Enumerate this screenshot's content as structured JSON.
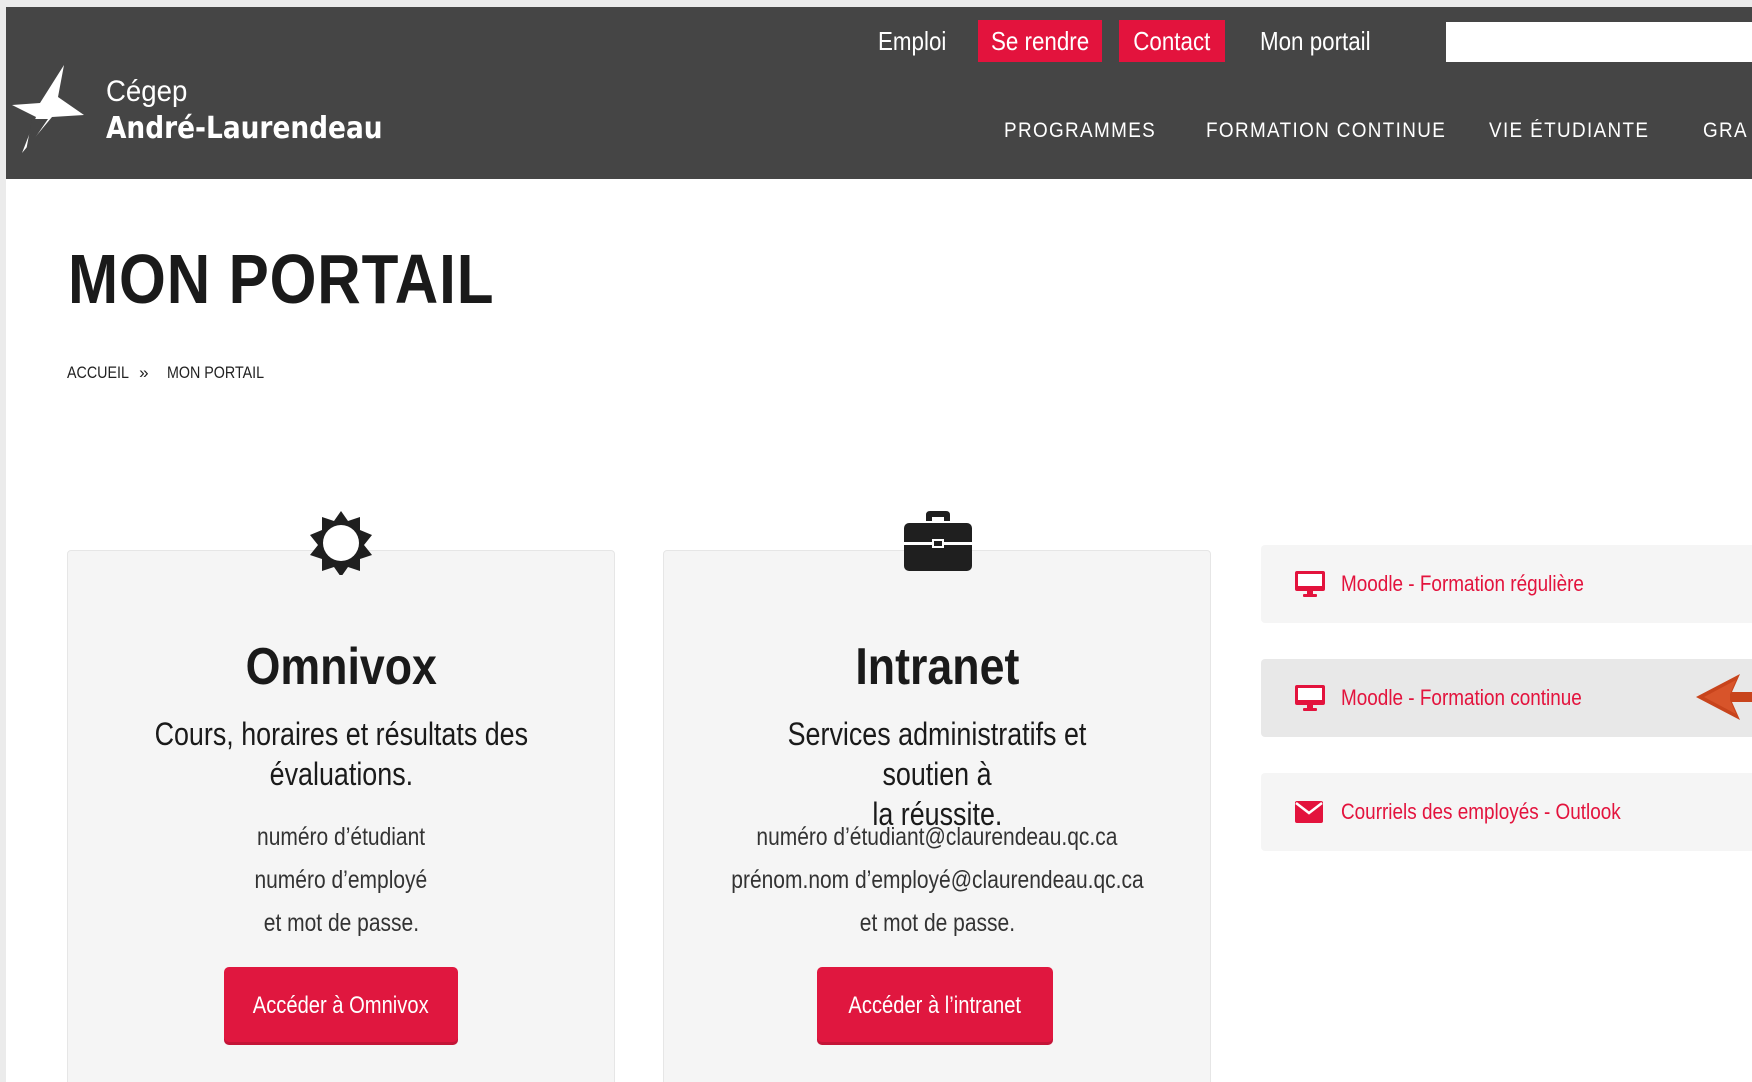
{
  "header": {
    "logo": {
      "line1": "Cégep",
      "line2": "André-Laurendeau"
    },
    "utility_nav": {
      "emploi": "Emploi",
      "se_rendre": "Se rendre",
      "contact": "Contact",
      "mon_portail": "Mon portail",
      "search_value": ""
    },
    "main_nav": [
      "PROGRAMMES",
      "FORMATION CONTINUE",
      "VIE ÉTUDIANTE",
      "GRA"
    ]
  },
  "page": {
    "title": "MON PORTAIL",
    "breadcrumb": {
      "home": "ACCUEIL",
      "separator": "»",
      "current": "MON PORTAIL"
    }
  },
  "cards": [
    {
      "icon": "gear-icon",
      "title": "Omnivox",
      "subtitle_line1": "Cours, horaires et résultats des",
      "subtitle_line2": "évaluations.",
      "lines": [
        "numéro d’étudiant",
        "numéro d’employé",
        "et mot de passe."
      ],
      "button": "Accéder à Omnivox"
    },
    {
      "icon": "briefcase-icon",
      "title": "Intranet",
      "subtitle_line1": "Services administratifs et soutien à",
      "subtitle_line2": "la réussite.",
      "lines": [
        "numéro d’étudiant@claurendeau.qc.ca",
        "prénom.nom d’employé@claurendeau.qc.ca",
        "et mot de passe."
      ],
      "button": "Accéder à l’intranet"
    }
  ],
  "quick_links": [
    {
      "icon": "monitor-icon",
      "label": "Moodle - Formation régulière"
    },
    {
      "icon": "monitor-icon",
      "label": "Moodle - Formation continue"
    },
    {
      "icon": "envelope-icon",
      "label": "Courriels des employés - Outlook"
    }
  ],
  "colors": {
    "header_bg": "#454545",
    "accent_red": "#e3133d",
    "card_bg": "#f5f5f5",
    "annotation_arrow": "#c8441c"
  }
}
